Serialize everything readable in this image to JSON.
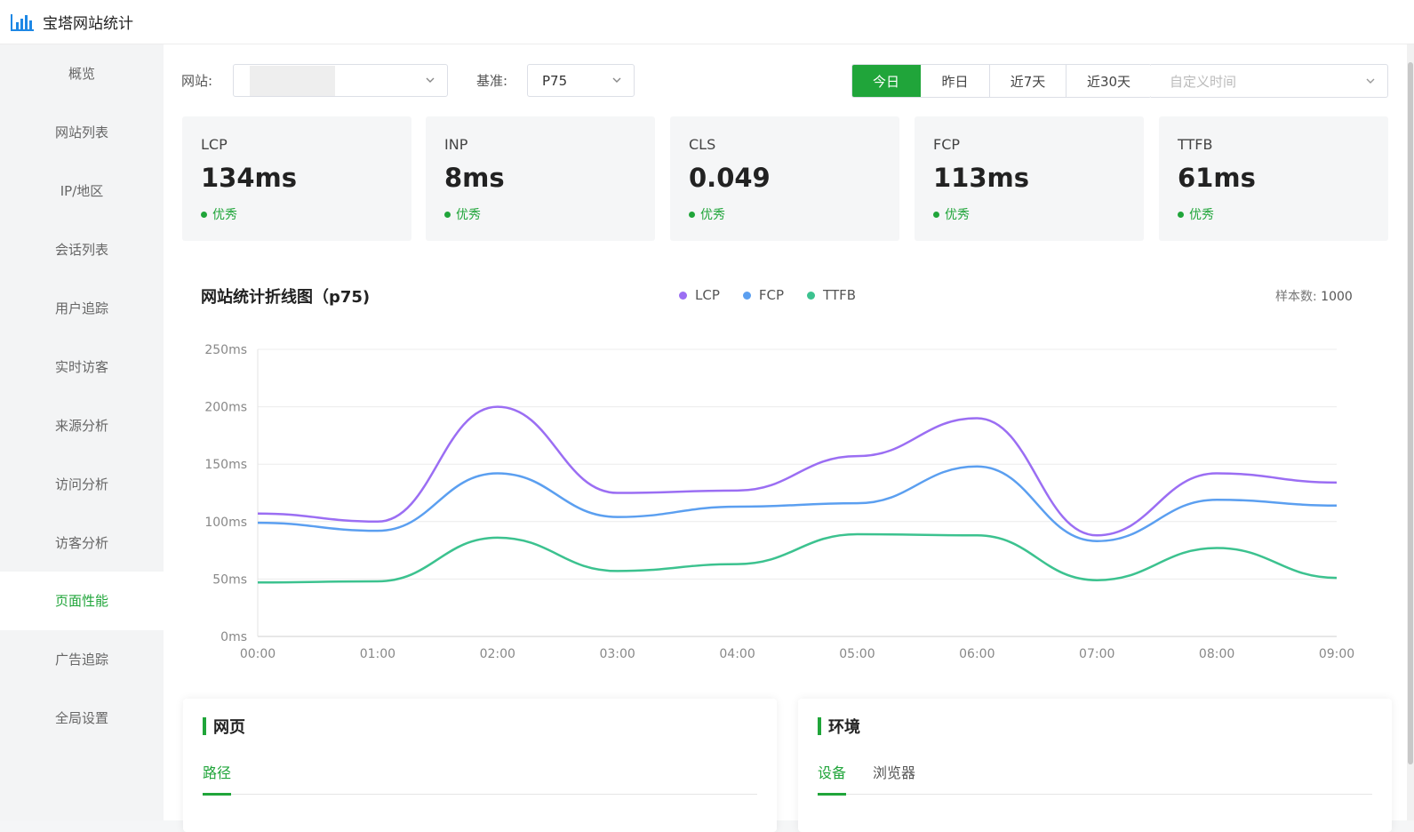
{
  "app": {
    "title": "宝塔网站统计",
    "logo_icon": "bar-chart-icon",
    "accent": "#20a53a"
  },
  "sidebar": {
    "items": [
      {
        "label": "概览",
        "active": false
      },
      {
        "label": "网站列表",
        "active": false
      },
      {
        "label": "IP/地区",
        "active": false
      },
      {
        "label": "会话列表",
        "active": false
      },
      {
        "label": "用户追踪",
        "active": false
      },
      {
        "label": "实时访客",
        "active": false
      },
      {
        "label": "来源分析",
        "active": false
      },
      {
        "label": "访问分析",
        "active": false
      },
      {
        "label": "访客分析",
        "active": false
      },
      {
        "label": "页面性能",
        "active": true
      },
      {
        "label": "广告追踪",
        "active": false
      },
      {
        "label": "全局设置",
        "active": false
      }
    ]
  },
  "filters": {
    "site_label": "网站:",
    "site_value": "",
    "baseline_label": "基准:",
    "baseline_value": "P75",
    "ranges": [
      {
        "label": "今日",
        "active": true
      },
      {
        "label": "昨日",
        "active": false
      },
      {
        "label": "近7天",
        "active": false
      },
      {
        "label": "近30天",
        "active": false
      }
    ],
    "date_placeholder": "自定义时间"
  },
  "metrics": [
    {
      "name": "LCP",
      "value": "134ms",
      "status": "优秀"
    },
    {
      "name": "INP",
      "value": "8ms",
      "status": "优秀"
    },
    {
      "name": "CLS",
      "value": "0.049",
      "status": "优秀"
    },
    {
      "name": "FCP",
      "value": "113ms",
      "status": "优秀"
    },
    {
      "name": "TTFB",
      "value": "61ms",
      "status": "优秀"
    }
  ],
  "chart_data": {
    "type": "line",
    "title": "网站统计折线图（p75)",
    "sample_label": "样本数:",
    "sample_value": "1000",
    "x": [
      "00:00",
      "01:00",
      "02:00",
      "03:00",
      "04:00",
      "05:00",
      "06:00",
      "07:00",
      "08:00",
      "09:00"
    ],
    "y_ticks": [
      "0ms",
      "50ms",
      "100ms",
      "150ms",
      "200ms",
      "250ms"
    ],
    "ylim": [
      0,
      250
    ],
    "grid": true,
    "legend_position": "top-center",
    "series": [
      {
        "name": "LCP",
        "color": "#9b6ef3",
        "values": [
          107,
          100,
          200,
          125,
          127,
          157,
          190,
          88,
          142,
          134
        ]
      },
      {
        "name": "FCP",
        "color": "#5b9ff0",
        "values": [
          99,
          92,
          142,
          104,
          113,
          116,
          148,
          83,
          119,
          114
        ]
      },
      {
        "name": "TTFB",
        "color": "#3cc28f",
        "values": [
          47,
          48,
          86,
          57,
          63,
          89,
          88,
          49,
          77,
          51
        ]
      }
    ]
  },
  "panels": {
    "left": {
      "title": "网页",
      "tabs": [
        {
          "label": "路径",
          "active": true
        }
      ]
    },
    "right": {
      "title": "环境",
      "tabs": [
        {
          "label": "设备",
          "active": true
        },
        {
          "label": "浏览器",
          "active": false
        }
      ]
    }
  }
}
